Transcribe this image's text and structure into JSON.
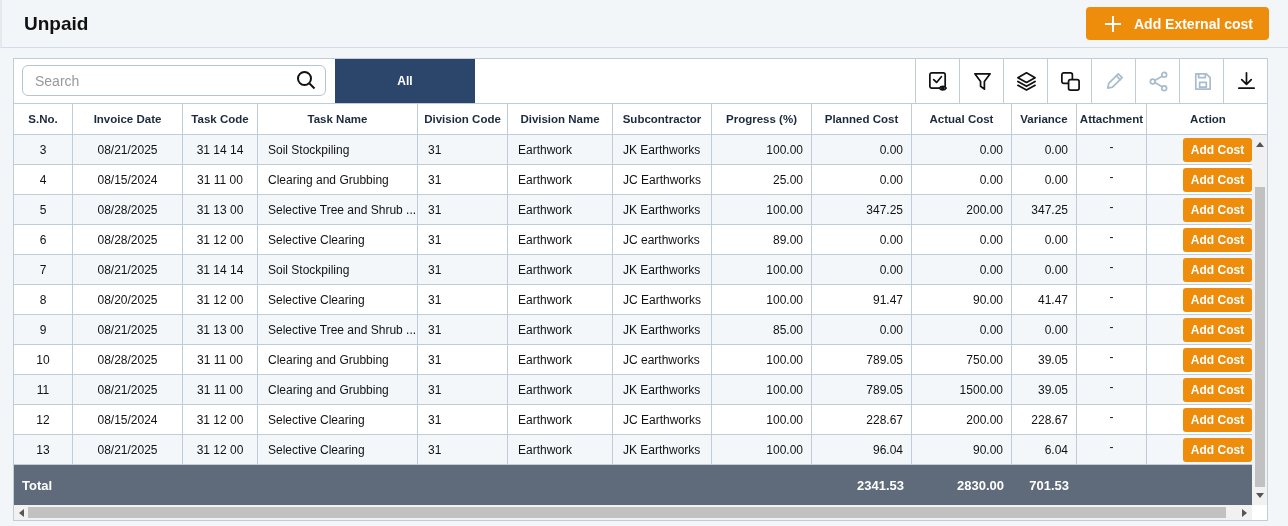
{
  "page": {
    "title": "Unpaid",
    "add_button": {
      "label": "Add External cost"
    }
  },
  "search": {
    "placeholder": "Search"
  },
  "tabs": [
    {
      "label": "All",
      "selected": true
    }
  ],
  "toolbar": [
    {
      "kind": "preview",
      "disabled": false
    },
    {
      "kind": "filter",
      "disabled": false
    },
    {
      "kind": "layers",
      "disabled": false
    },
    {
      "kind": "copy",
      "disabled": false
    },
    {
      "kind": "edit",
      "disabled": true
    },
    {
      "kind": "share",
      "disabled": true
    },
    {
      "kind": "save",
      "disabled": true
    },
    {
      "kind": "download",
      "disabled": false
    }
  ],
  "table": {
    "columns": [
      "S.No.",
      "Invoice Date",
      "Task Code",
      "Task Name",
      "Division Code",
      "Division Name",
      "Subcontractor",
      "Progress (%)",
      "Planned Cost",
      "Actual Cost",
      "Variance",
      "Attachment",
      "Action"
    ],
    "rows": [
      {
        "cells": [
          "3",
          "08/21/2025",
          "31 14 14",
          "Soil Stockpiling",
          "31",
          "Earthwork",
          "JK Earthworks",
          "100.00",
          "0.00",
          "0.00",
          "0.00",
          "-"
        ],
        "action": "Add Cost"
      },
      {
        "cells": [
          "4",
          "08/15/2024",
          "31 11 00",
          "Clearing and Grubbing",
          "31",
          "Earthwork",
          "JC Earthworks",
          "25.00",
          "0.00",
          "0.00",
          "0.00",
          "-"
        ],
        "action": "Add Cost"
      },
      {
        "cells": [
          "5",
          "08/28/2025",
          "31 13 00",
          "Selective Tree and Shrub ...",
          "31",
          "Earthwork",
          "JK Earthworks",
          "100.00",
          "347.25",
          "200.00",
          "347.25",
          "-"
        ],
        "action": "Add Cost"
      },
      {
        "cells": [
          "6",
          "08/28/2025",
          "31 12 00",
          "Selective Clearing",
          "31",
          "Earthwork",
          "JC earthworks",
          "89.00",
          "0.00",
          "0.00",
          "0.00",
          "-"
        ],
        "action": "Add Cost"
      },
      {
        "cells": [
          "7",
          "08/21/2025",
          "31 14 14",
          "Soil Stockpiling",
          "31",
          "Earthwork",
          "JK Earthworks",
          "100.00",
          "0.00",
          "0.00",
          "0.00",
          "-"
        ],
        "action": "Add Cost"
      },
      {
        "cells": [
          "8",
          "08/20/2025",
          "31 12 00",
          "Selective Clearing",
          "31",
          "Earthwork",
          "JC Earthworks",
          "100.00",
          "91.47",
          "90.00",
          "41.47",
          "-"
        ],
        "action": "Add Cost"
      },
      {
        "cells": [
          "9",
          "08/21/2025",
          "31 13 00",
          "Selective Tree and Shrub ...",
          "31",
          "Earthwork",
          "JK Earthworks",
          "85.00",
          "0.00",
          "0.00",
          "0.00",
          "-"
        ],
        "action": "Add Cost"
      },
      {
        "cells": [
          "10",
          "08/28/2025",
          "31 11 00",
          "Clearing and Grubbing",
          "31",
          "Earthwork",
          "JC earthworks",
          "100.00",
          "789.05",
          "750.00",
          "39.05",
          "-"
        ],
        "action": "Add Cost"
      },
      {
        "cells": [
          "11",
          "08/21/2025",
          "31 11 00",
          "Clearing and Grubbing",
          "31",
          "Earthwork",
          "JK Earthworks",
          "100.00",
          "789.05",
          "1500.00",
          "39.05",
          "-"
        ],
        "action": "Add Cost"
      },
      {
        "cells": [
          "12",
          "08/15/2024",
          "31 12 00",
          "Selective Clearing",
          "31",
          "Earthwork",
          "JC Earthworks",
          "100.00",
          "228.67",
          "200.00",
          "228.67",
          "-"
        ],
        "action": "Add Cost"
      },
      {
        "cells": [
          "13",
          "08/21/2025",
          "31 12 00",
          "Selective Clearing",
          "31",
          "Earthwork",
          "JK Earthworks",
          "100.00",
          "96.04",
          "90.00",
          "6.04",
          "-"
        ],
        "action": "Add Cost"
      }
    ],
    "total": {
      "label": "Total",
      "planned_cost": "2341.53",
      "actual_cost": "2830.00",
      "variance": "701.53"
    }
  }
}
